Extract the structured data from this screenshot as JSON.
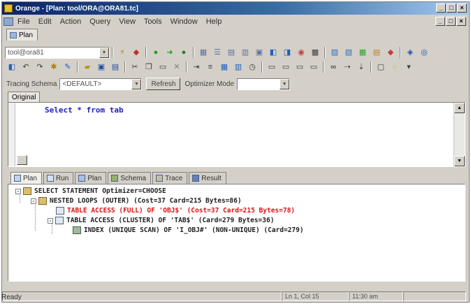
{
  "window": {
    "title": "Orange - [Plan: tool/ORA@ORA81.tc]"
  },
  "title_controls": [
    "_",
    "□",
    "×"
  ],
  "menubar": {
    "items": [
      "File",
      "Edit",
      "Action",
      "Query",
      "View",
      "Tools",
      "Window",
      "Help"
    ],
    "mdi_controls": [
      "_",
      "□",
      "×"
    ]
  },
  "doc_tab": {
    "label": "Plan"
  },
  "toolbar": {
    "connection_value": "tool@ora81",
    "dropdown_arrow": "▼"
  },
  "options": {
    "schema_label": "Tracing Schema",
    "schema_value": "<DEFAULT>",
    "refresh_label": "Refresh",
    "mode_label": "Optimizer Mode",
    "mode_value": ""
  },
  "editor": {
    "tab_label": "Original",
    "code": "Select * from tab"
  },
  "plan_tabs": [
    {
      "label": "Plan",
      "active": true
    },
    {
      "label": "Run"
    },
    {
      "label": "Plan"
    },
    {
      "label": "Schema"
    },
    {
      "label": "Trace"
    },
    {
      "label": "Result"
    }
  ],
  "plan": {
    "nodes": [
      {
        "text": "SELECT STATEMENT Optimizer=CHOOSE",
        "expander": "-"
      },
      {
        "text": "NESTED LOOPS (OUTER) (Cost=37 Card=215 Bytes=86)",
        "expander": "-"
      },
      {
        "text": "TABLE ACCESS (FULL) OF 'OBJ$' (Cost=37 Card=215 Bytes=78)",
        "red": true
      },
      {
        "text": "TABLE ACCESS (CLUSTER) OF 'TAB$' (Card=279 Bytes=36)",
        "expander": "-"
      },
      {
        "text": "INDEX (UNIQUE SCAN) OF 'I_OBJ#' (NON-UNIQUE) (Card=279)"
      }
    ]
  },
  "statusbar": {
    "position": "Ln 1, Col 15",
    "time": "11:30 am"
  },
  "status_text": "Ready"
}
